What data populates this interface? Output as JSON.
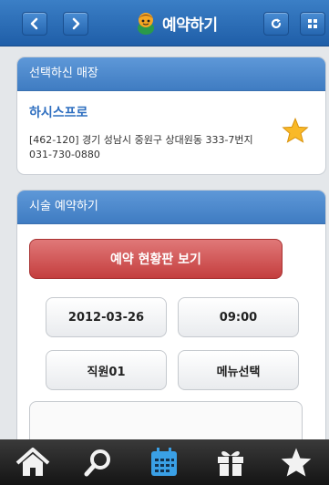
{
  "header": {
    "title": "예약하기",
    "icons": [
      "chevron-left-icon",
      "chevron-right-icon",
      "mascot-icon",
      "refresh-icon",
      "grid-menu-icon"
    ]
  },
  "store_panel": {
    "heading": "선택하신 매장",
    "name": "하시스프로",
    "address": "[462-120] 경기 성남시 중원구 상대원동 333-7번지",
    "phone": "031-730-0880"
  },
  "booking_panel": {
    "heading": "시술 예약하기",
    "status_button": "예약 현황판 보기",
    "date": "2012-03-26",
    "time": "09:00",
    "staff": "직원01",
    "menu_button": "메뉴선택"
  },
  "tabbar": {
    "items": [
      "home-icon",
      "search-icon",
      "calendar-icon",
      "gift-icon",
      "star-icon"
    ],
    "active": "calendar-icon"
  },
  "colors": {
    "header_blue": "#1f5ea8",
    "panel_head_blue": "#4a86cc",
    "accent_red": "#c43e3e",
    "link_blue": "#2f6fc0",
    "active_tab": "#3aa0e6"
  }
}
